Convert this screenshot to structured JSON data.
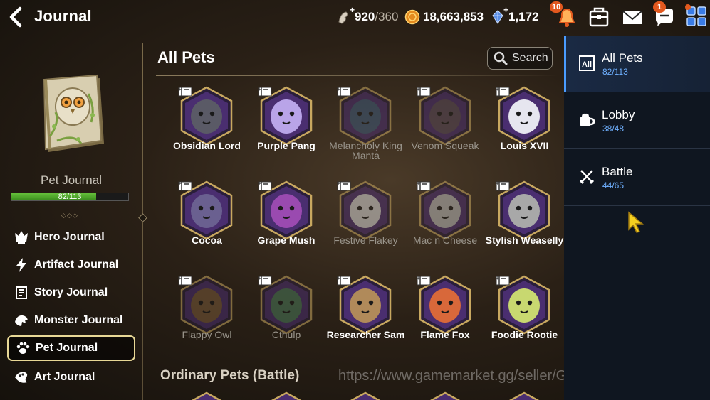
{
  "header": {
    "title": "Journal",
    "stamina": {
      "value": "920",
      "max": "/360"
    },
    "gold": "18,663,853",
    "gems": "1,172",
    "notifications_badge": "10",
    "chat_badge": "1"
  },
  "left": {
    "pet_journal_label": "Pet Journal",
    "progress_text": "82/113",
    "progress": 0.7257,
    "menu": [
      {
        "label": "Hero Journal",
        "icon": "hero-icon"
      },
      {
        "label": "Artifact Journal",
        "icon": "artifact-icon"
      },
      {
        "label": "Story Journal",
        "icon": "story-icon"
      },
      {
        "label": "Monster Journal",
        "icon": "monster-icon"
      },
      {
        "label": "Pet Journal",
        "icon": "paw-icon",
        "active": true
      },
      {
        "label": "Art Journal",
        "icon": "art-icon"
      }
    ]
  },
  "main": {
    "section_title": "All Pets",
    "search_label": "Search",
    "sub_section_title": "Ordinary Pets (Battle)",
    "watermark": "https://www.gamemarket.gg/seller/GameNews",
    "pets": [
      {
        "name": "Obsidian Lord",
        "owned": true,
        "color": "#5a5a66"
      },
      {
        "name": "Purple Pang",
        "owned": true,
        "color": "#b9a4e8"
      },
      {
        "name": "Melancholy King Manta",
        "owned": false,
        "color": "#3e5a7a"
      },
      {
        "name": "Venom Squeak",
        "owned": false,
        "color": "#5a4a5a"
      },
      {
        "name": "Louis XVII",
        "owned": true,
        "color": "#e6e6ef"
      },
      {
        "name": "Cocoa",
        "owned": true,
        "color": "#6a6090"
      },
      {
        "name": "Grape Mush",
        "owned": true,
        "color": "#9a4ab0"
      },
      {
        "name": "Festive Flakey",
        "owned": false,
        "color": "#d8d8d8"
      },
      {
        "name": "Mac n Cheese",
        "owned": false,
        "color": "#bcbcbc"
      },
      {
        "name": "Stylish Weaselly",
        "owned": true,
        "color": "#a8a8a8"
      },
      {
        "name": "Flappy Owl",
        "owned": false,
        "color": "#7a5a3a"
      },
      {
        "name": "Cthulp",
        "owned": false,
        "color": "#4a7a5a"
      },
      {
        "name": "Researcher Sam",
        "owned": true,
        "color": "#b08a5a"
      },
      {
        "name": "Flame Fox",
        "owned": true,
        "color": "#d8683a"
      },
      {
        "name": "Foodie Rootie",
        "owned": true,
        "color": "#c8d870"
      }
    ]
  },
  "right": {
    "categories": [
      {
        "label": "All Pets",
        "count": "82/113",
        "icon": "all-icon",
        "active": true
      },
      {
        "label": "Lobby",
        "count": "38/48",
        "icon": "lobby-icon",
        "active": false
      },
      {
        "label": "Battle",
        "count": "44/65",
        "icon": "crossed-swords-icon",
        "active": false
      }
    ]
  }
}
